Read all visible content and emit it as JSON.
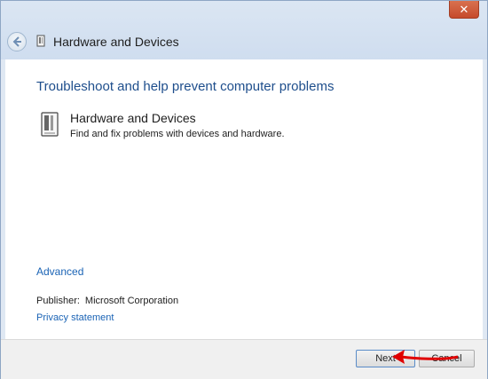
{
  "window": {
    "title": "Hardware and Devices",
    "close_glyph": "✕"
  },
  "content": {
    "heading": "Troubleshoot and help prevent computer problems",
    "item": {
      "title": "Hardware and Devices",
      "description": "Find and fix problems with devices and hardware.",
      "icon": "hardware-icon"
    },
    "advanced_link": "Advanced",
    "publisher_label": "Publisher:",
    "publisher_value": "Microsoft Corporation",
    "privacy_link": "Privacy statement"
  },
  "footer": {
    "next_label": "Next",
    "cancel_label": "Cancel"
  },
  "colors": {
    "heading": "#1e4e8c",
    "link": "#1a63b5",
    "annotation_arrow": "#e00000"
  }
}
